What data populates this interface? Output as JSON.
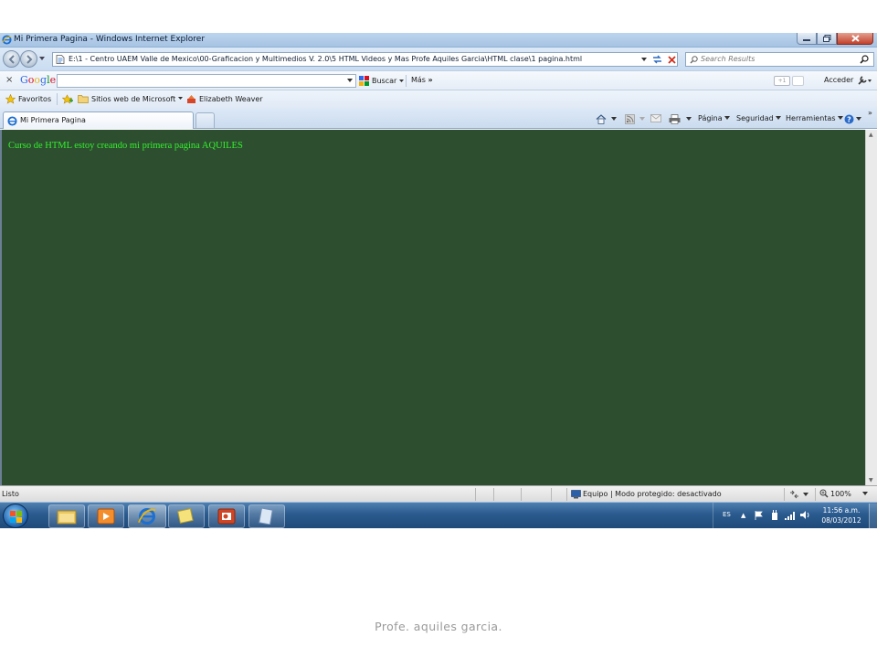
{
  "window": {
    "title": "Mi Primera Pagina - Windows Internet Explorer",
    "url": "E:\\1 - Centro UAEM Valle de Mexico\\00-Graficacion y Multimedios V. 2.0\\5 HTML Videos y Mas  Profe Aquiles Garcia\\HTML clase\\1 pagina.html",
    "search_placeholder": "Search Results"
  },
  "google_toolbar": {
    "logo": "Google",
    "search_label": "Buscar",
    "more_label": "Más",
    "plus_label": "+1",
    "signin_label": "Acceder"
  },
  "favorites_bar": {
    "favorites_label": "Favoritos",
    "items": [
      "Sitios web de Microsoft",
      "Elizabeth Weaver"
    ]
  },
  "tabs": {
    "active_label": "Mi Primera Pagina"
  },
  "commands": {
    "page": "Página",
    "security": "Seguridad",
    "tools": "Herramientas"
  },
  "content": {
    "text": "Curso de HTML estoy creando mi primera pagina AQUILES",
    "background_color": "#2d4f30",
    "text_color": "#35ef2e"
  },
  "status_bar": {
    "status": "Listo",
    "zone": "Equipo | Modo protegido: desactivado",
    "zoom": "100%"
  },
  "taskbar": {
    "language": "ES",
    "time": "11:56 a.m.",
    "date": "08/03/2012"
  },
  "caption": "Profe. aquiles garcia."
}
